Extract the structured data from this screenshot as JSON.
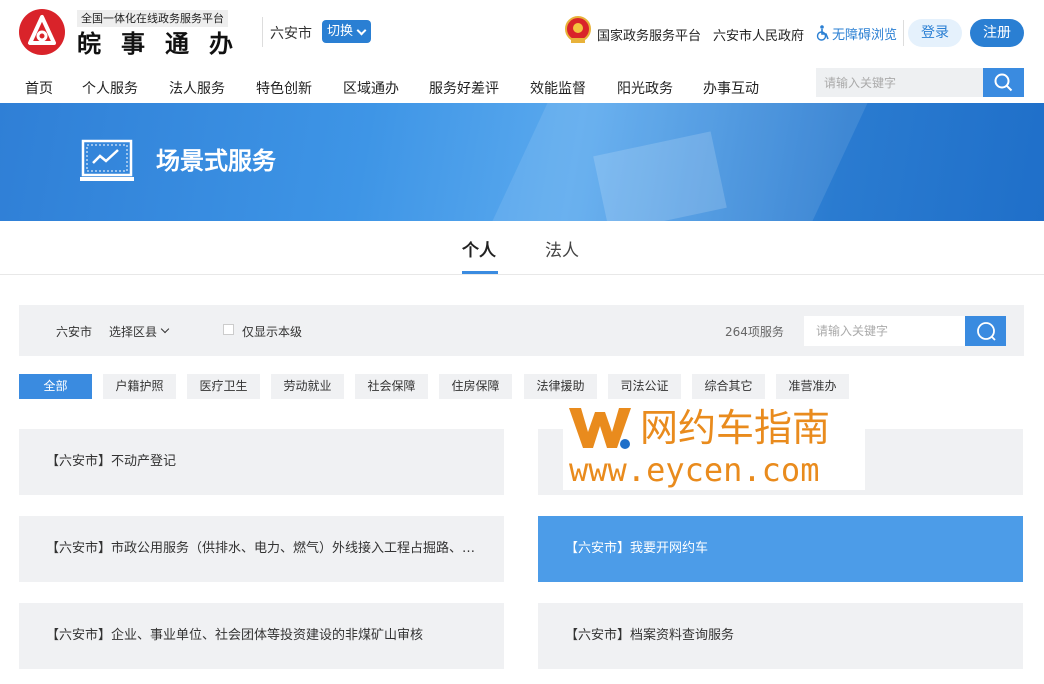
{
  "header": {
    "platform_tag": "全国一体化在线政务服务平台",
    "brand": "皖事通办",
    "city": "六安市",
    "switch_label": "切换",
    "national_platform": "国家政务服务平台",
    "city_government": "六安市人民政府",
    "accessibility": "无障碍浏览",
    "login": "登录",
    "register": "注册"
  },
  "nav": {
    "items": [
      "首页",
      "个人服务",
      "法人服务",
      "特色创新",
      "区域通办",
      "服务好差评",
      "效能监督",
      "阳光政务",
      "办事互动"
    ],
    "search_placeholder": "请输入关键字"
  },
  "banner": {
    "title": "场景式服务"
  },
  "tabs": {
    "items": [
      "个人",
      "法人"
    ],
    "active": "个人"
  },
  "filter": {
    "city": "六安市",
    "district_select": "选择区县",
    "only_this_level": "仅显示本级",
    "service_count": "264项服务",
    "search_placeholder": "请输入关键字"
  },
  "categories": [
    "全部",
    "户籍护照",
    "医疗卫生",
    "劳动就业",
    "社会保障",
    "住房保障",
    "法律援助",
    "司法公证",
    "综合其它",
    "准营准办"
  ],
  "services": [
    "【六安市】不动产登记",
    "",
    "【六安市】市政公用服务（供排水、电力、燃气）外线接入工程占掘路、…",
    "【六安市】我要开网约车",
    "【六安市】企业、事业单位、社会团体等投资建设的非煤矿山审核",
    "【六安市】档案资料查询服务"
  ],
  "watermark": {
    "cn": "网约车指南",
    "url": "www.eycen.com"
  },
  "colors": {
    "primary": "#2a7fd3",
    "accent_blue": "#3a8be0",
    "logo_red": "#d9232a",
    "watermark_orange": "#e98b1d"
  }
}
